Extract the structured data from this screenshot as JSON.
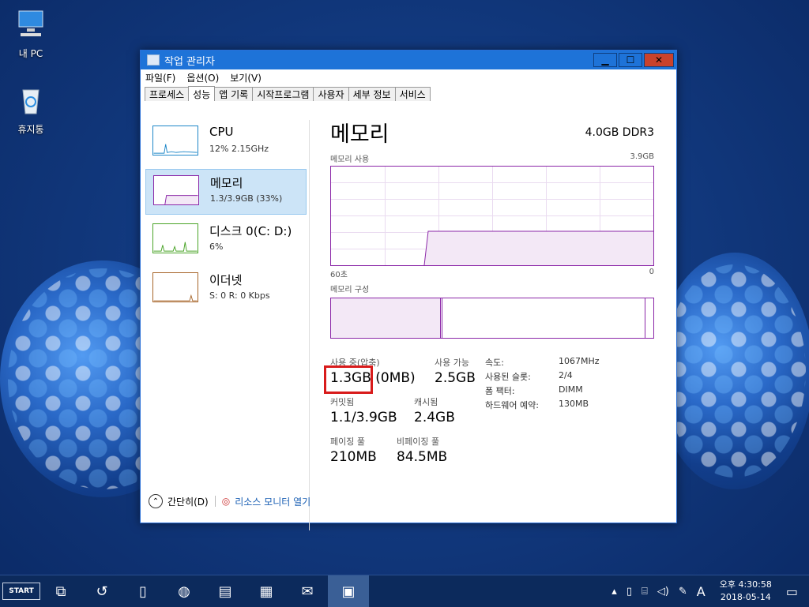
{
  "desktop": {
    "icons": [
      {
        "label": "내 PC"
      },
      {
        "label": "휴지통"
      }
    ]
  },
  "window": {
    "title": "작업 관리자",
    "controls": {
      "minimize": "▁",
      "maximize": "☐",
      "close": "✕"
    },
    "menu": [
      "파일(F)",
      "옵션(O)",
      "보기(V)"
    ],
    "tabs": [
      "프로세스",
      "성능",
      "앱 기록",
      "시작프로그램",
      "사용자",
      "세부 정보",
      "서비스"
    ],
    "active_tab": "성능",
    "sidebar": [
      {
        "name": "CPU",
        "value": "12% 2.15GHz",
        "color": "#1e87c8"
      },
      {
        "name": "메모리",
        "value": "1.3/3.9GB (33%)",
        "color": "#8b27a8"
      },
      {
        "name": "디스크 0(C: D:)",
        "value": "6%",
        "color": "#4aa428"
      },
      {
        "name": "이더넷",
        "value": "S: 0 R: 0 Kbps",
        "color": "#a7652a"
      }
    ],
    "memory": {
      "title": "메모리",
      "spec": "4.0GB DDR3",
      "usage_label": "메모리 사용",
      "usage_max": "3.9GB",
      "axis_left": "60초",
      "axis_right": "0",
      "composition_label": "메모리 구성",
      "stats": {
        "in_use_label": "사용 중(압축)",
        "in_use_value": "1.3GB (0MB)",
        "available_label": "사용 가능",
        "available_value": "2.5GB",
        "committed_label": "커밋됨",
        "committed_value": "1.1/3.9GB",
        "cached_label": "캐시됨",
        "cached_value": "2.4GB",
        "paged_label": "페이징 풀",
        "paged_value": "210MB",
        "nonpaged_label": "비페이징 풀",
        "nonpaged_value": "84.5MB"
      },
      "details": [
        {
          "k": "속도:",
          "v": "1067MHz"
        },
        {
          "k": "사용된 슬롯:",
          "v": "2/4"
        },
        {
          "k": "폼 팩터:",
          "v": "DIMM"
        },
        {
          "k": "하드웨어 예약:",
          "v": "130MB"
        }
      ]
    },
    "footer": {
      "fewer_details": "간단히(D)",
      "resource_monitor": "리소스 모니터 열기"
    }
  },
  "taskbar": {
    "start": "START",
    "tray_ime": "A",
    "time": "오후 4:30:58",
    "date": "2018-05-14"
  },
  "colors": {
    "accent": "#1e73d8",
    "memory": "#8b27a8",
    "highlight": "#d81b1b"
  }
}
